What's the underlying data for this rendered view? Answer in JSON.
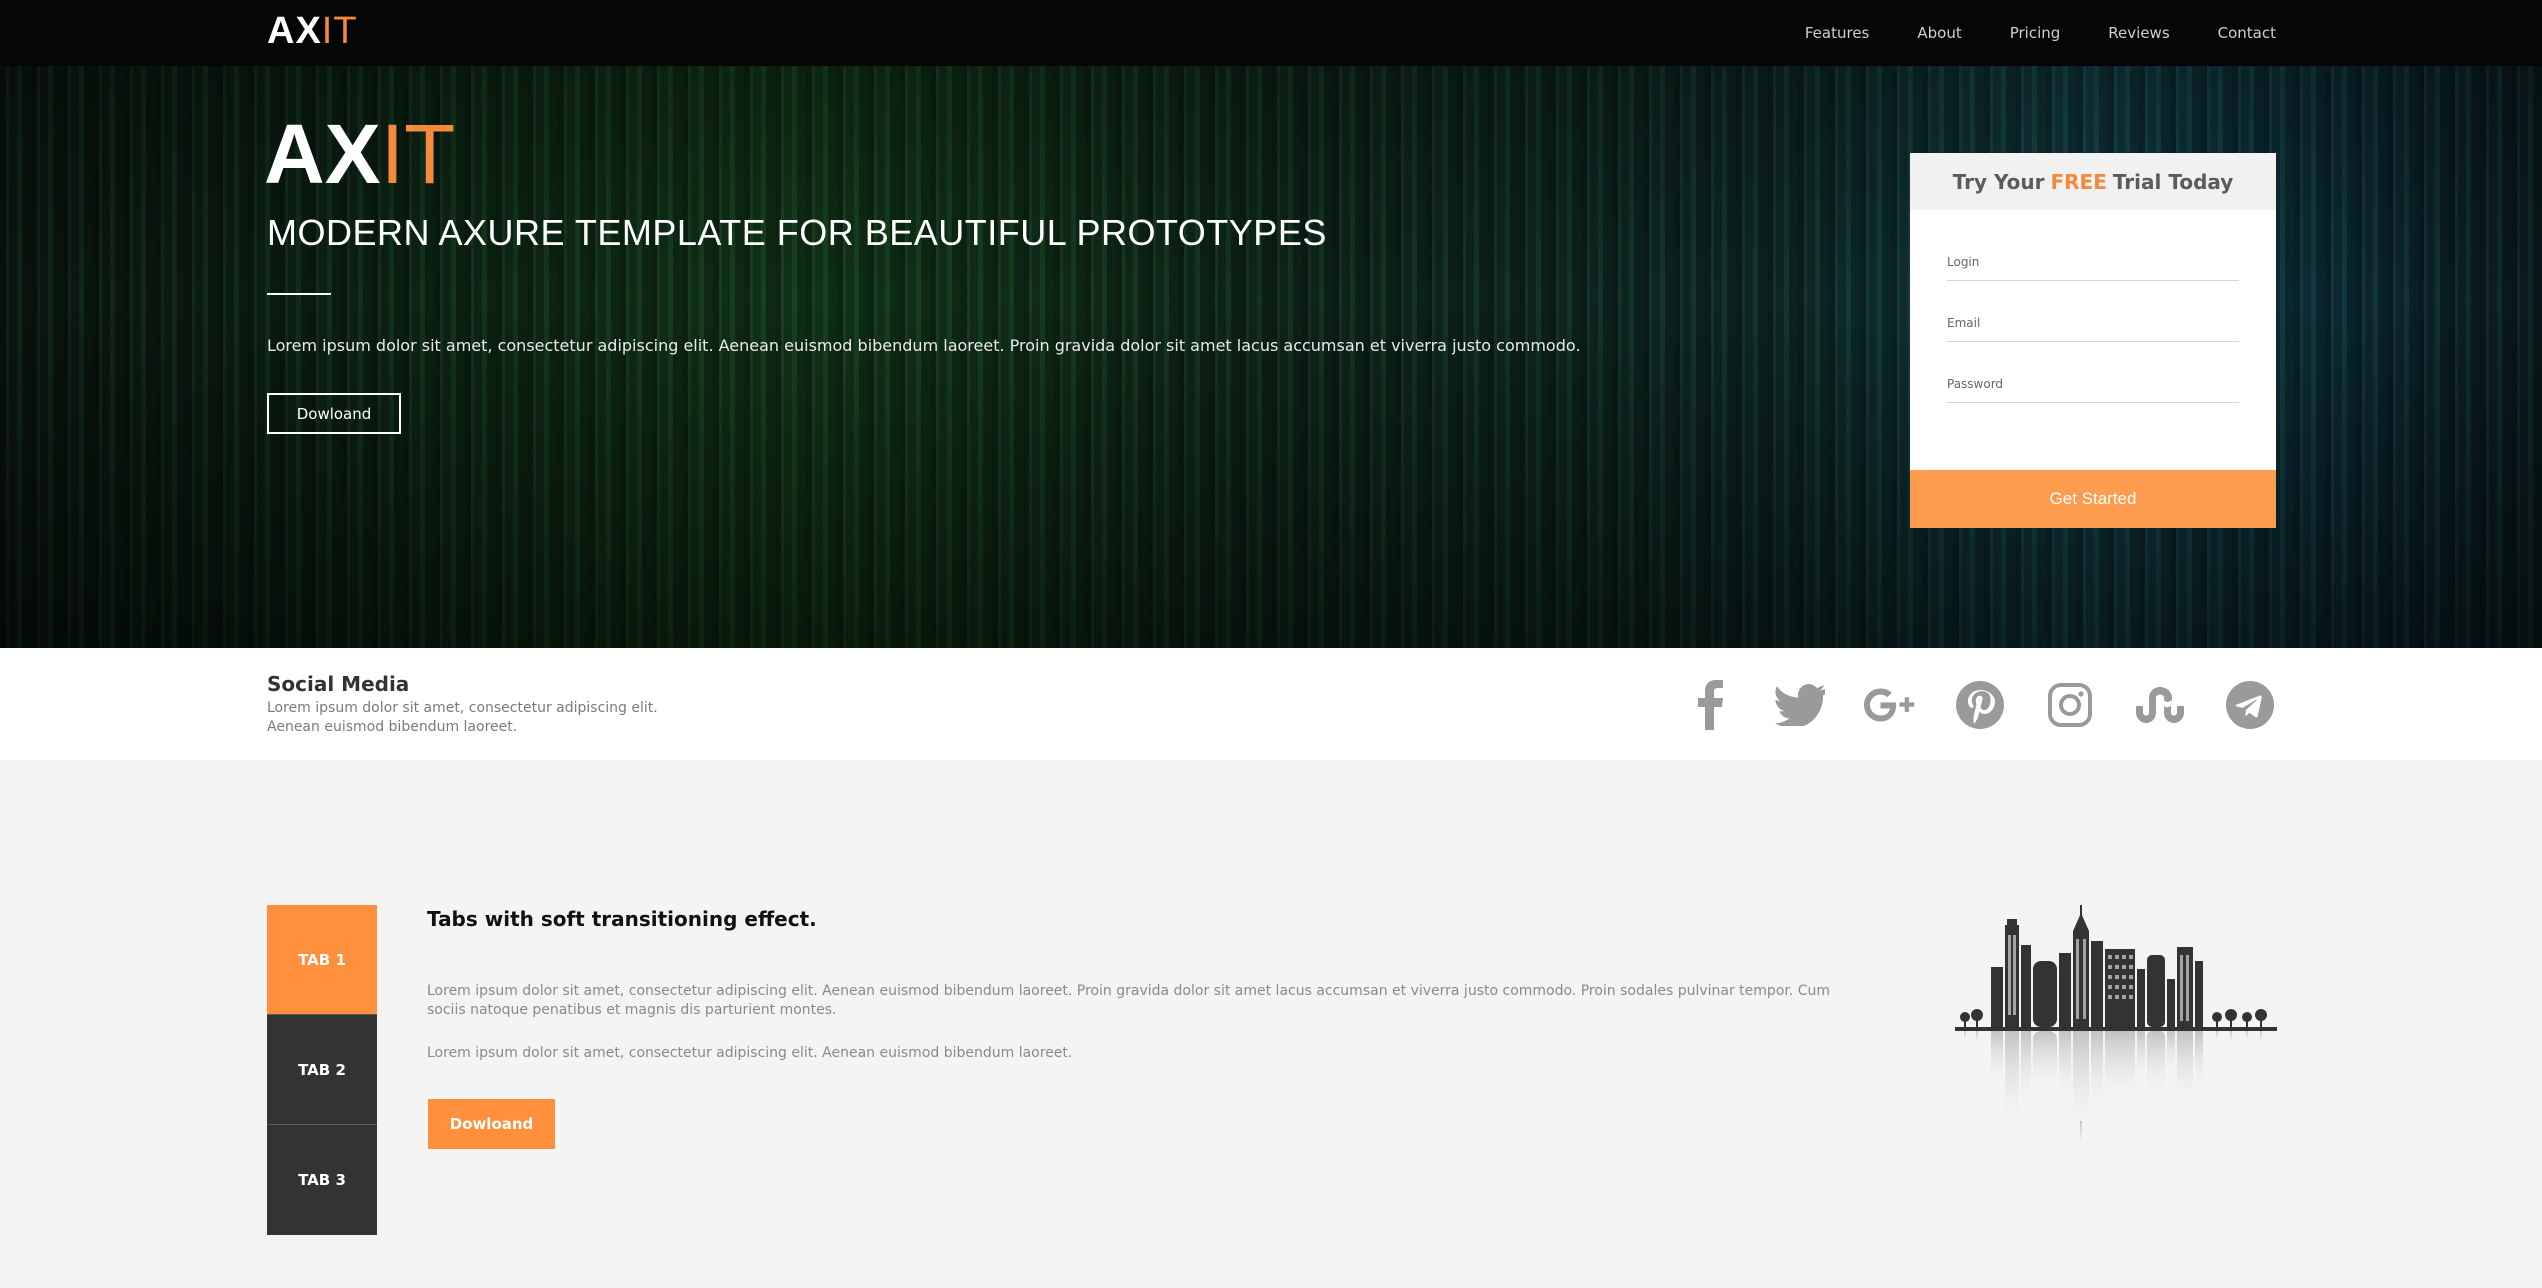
{
  "nav": {
    "logo_ax": "AX",
    "logo_it": "IT",
    "links": [
      "Features",
      "About",
      "Pricing",
      "Reviews",
      "Contact"
    ]
  },
  "hero": {
    "logo_ax": "AX",
    "logo_it": "IT",
    "title": "MODERN AXURE TEMPLATE FOR BEAUTIFUL PROTOTYPES",
    "text": "Lorem ipsum dolor sit amet, consectetur adipiscing elit. Aenean euismod bibendum laoreet. Proin gravida dolor sit amet lacus accumsan et viverra justo commodo.",
    "button": "Dowloand"
  },
  "trial": {
    "head_pre": "Try Your",
    "head_free": "FREE",
    "head_post": "Trial Today",
    "login_placeholder": "Login",
    "email_placeholder": "Email",
    "password_placeholder": "Password",
    "button": "Get Started"
  },
  "social": {
    "title": "Social Media",
    "desc_line1": "Lorem ipsum dolor sit amet, consectetur adipiscing elit.",
    "desc_line2": "Aenean euismod bibendum laoreet.",
    "icons": [
      "facebook-icon",
      "twitter-icon",
      "google-plus-icon",
      "pinterest-icon",
      "instagram-icon",
      "stumbleupon-icon",
      "telegram-icon"
    ]
  },
  "tabs": {
    "items": [
      "TAB 1",
      "TAB 2",
      "TAB 3"
    ],
    "title": "Tabs with soft transitioning effect.",
    "p1": "Lorem ipsum dolor sit amet, consectetur adipiscing elit. Aenean euismod bibendum laoreet. Proin gravida dolor sit amet lacus accumsan et viverra justo commodo. Proin sodales pulvinar tempor. Cum sociis natoque penatibus et magnis dis parturient montes.",
    "p2": "Lorem ipsum dolor sit amet, consectetur adipiscing elit. Aenean euismod bibendum laoreet.",
    "button": "Dowloand"
  },
  "colors": {
    "accent": "#f58a3c",
    "nav_bg": "#050505",
    "tab_dark": "#333333",
    "social_icon": "#9a9a9a"
  }
}
